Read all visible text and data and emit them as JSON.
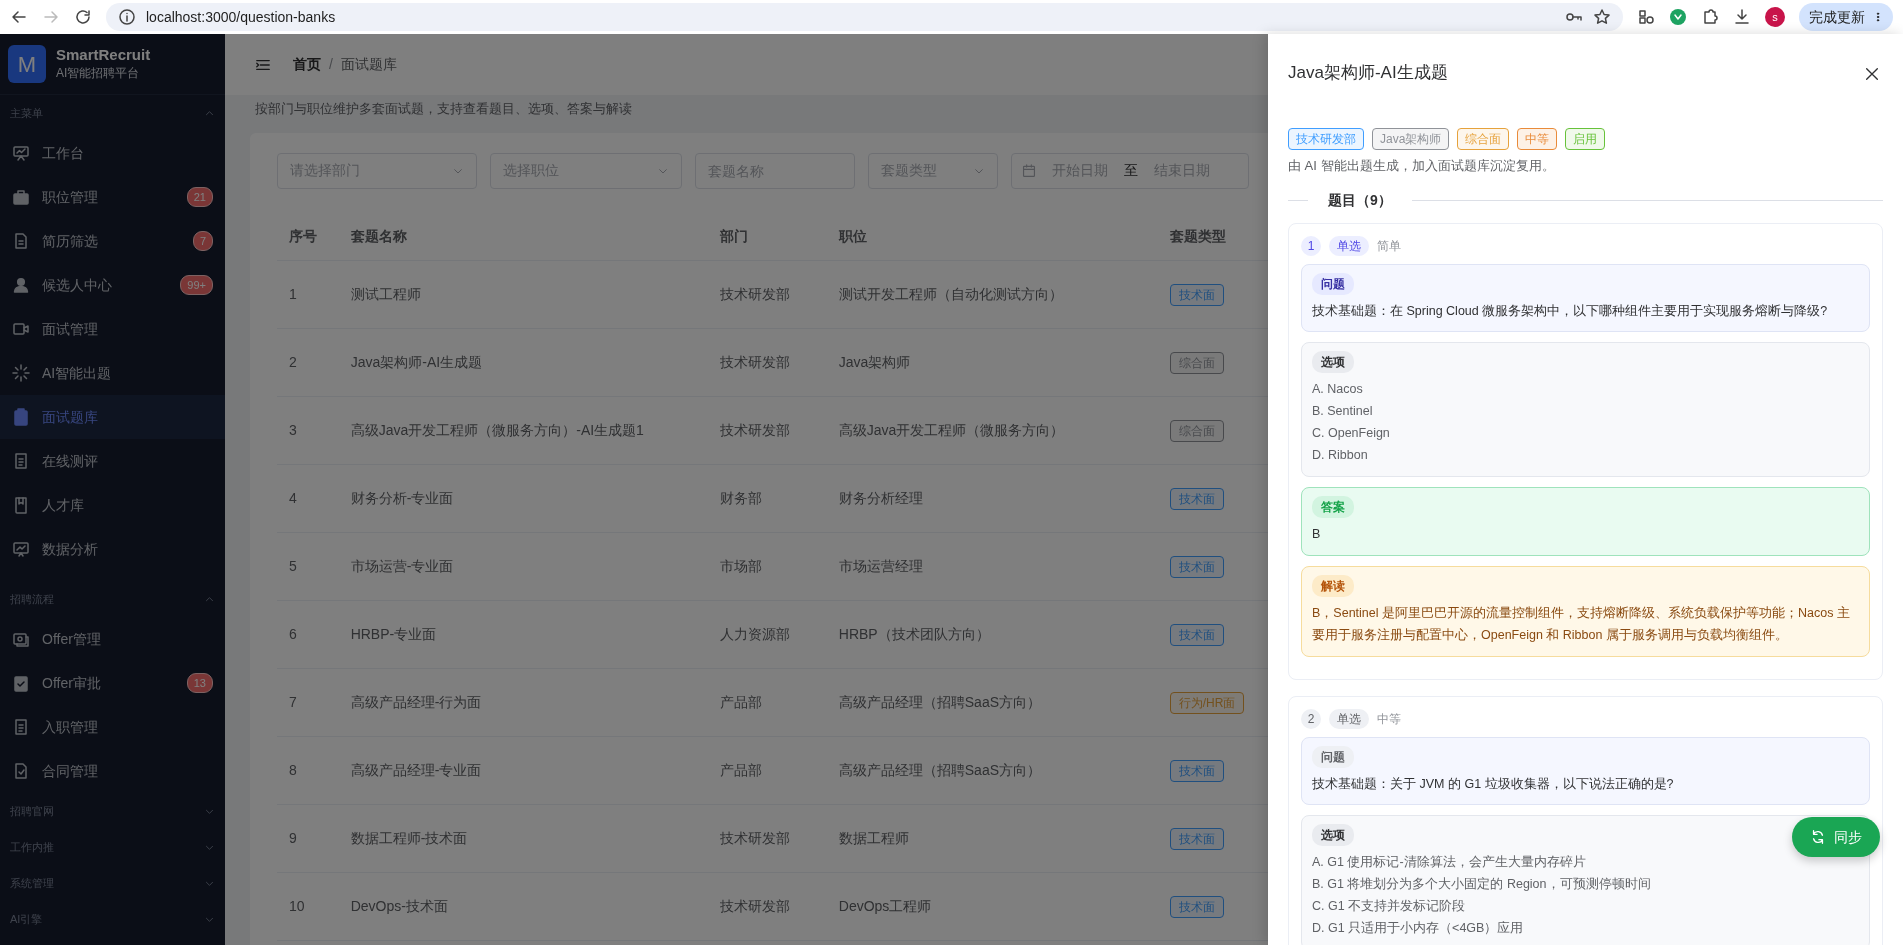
{
  "browser": {
    "url": "localhost:3000/question-banks",
    "avatar": "s",
    "update_button": "完成更新"
  },
  "sidebar": {
    "logo": "M",
    "name": "SmartRecruit",
    "subtitle": "AI智能招聘平台",
    "sections": [
      {
        "title": "主菜单",
        "expanded": true,
        "items": [
          {
            "label": "工作台",
            "selected": false
          },
          {
            "label": "职位管理",
            "badge": "21",
            "selected": false
          },
          {
            "label": "简历筛选",
            "badge": "7",
            "selected": false
          },
          {
            "label": "候选人中心",
            "badge": "99+",
            "selected": false
          },
          {
            "label": "面试管理",
            "selected": false
          },
          {
            "label": "AI智能出题",
            "selected": false
          },
          {
            "label": "面试题库",
            "selected": true
          },
          {
            "label": "在线测评",
            "selected": false
          },
          {
            "label": "人才库",
            "selected": false
          },
          {
            "label": "数据分析",
            "selected": false
          }
        ]
      },
      {
        "title": "招聘流程",
        "expanded": true,
        "items": [
          {
            "label": "Offer管理",
            "selected": false
          },
          {
            "label": "Offer审批",
            "badge": "13",
            "selected": false
          },
          {
            "label": "入职管理",
            "selected": false
          },
          {
            "label": "合同管理",
            "selected": false
          }
        ]
      },
      {
        "title": "招聘官网",
        "expanded": false
      },
      {
        "title": "工作内推",
        "expanded": false
      },
      {
        "title": "系统管理",
        "expanded": false
      },
      {
        "title": "AI引擎",
        "expanded": false
      }
    ]
  },
  "main": {
    "breadcrumb": {
      "items": [
        "首页",
        "面试题库"
      ],
      "separator": "/"
    },
    "description": "按部门与职位维护多套面试题，支持查看题目、选项、答案与解读",
    "filters": [
      {
        "kind": "select",
        "placeholder": "请选择部门"
      },
      {
        "kind": "select",
        "placeholder": "选择职位"
      },
      {
        "kind": "input",
        "placeholder": "套题名称"
      },
      {
        "kind": "select",
        "placeholder": "套题类型"
      },
      {
        "kind": "daterange",
        "start_placeholder": "开始日期",
        "separator": "至",
        "end_placeholder": "结束日期"
      }
    ],
    "table": {
      "columns": [
        "序号",
        "套题名称",
        "部门",
        "职位",
        "套题类型"
      ],
      "rows": [
        {
          "index": "1",
          "name": "测试工程师",
          "department": "技术研发部",
          "position": "测试开发工程师（自动化测试方向）",
          "type": {
            "label": "技术面",
            "kind": "primary"
          }
        },
        {
          "index": "2",
          "name": "Java架构师-AI生成题",
          "department": "技术研发部",
          "position": "Java架构师",
          "type": {
            "label": "综合面",
            "kind": "info"
          }
        },
        {
          "index": "3",
          "name": "高级Java开发工程师（微服务方向）-AI生成题1",
          "department": "技术研发部",
          "position": "高级Java开发工程师（微服务方向）",
          "type": {
            "label": "综合面",
            "kind": "info"
          }
        },
        {
          "index": "4",
          "name": "财务分析-专业面",
          "department": "财务部",
          "position": "财务分析经理",
          "type": {
            "label": "技术面",
            "kind": "primary"
          }
        },
        {
          "index": "5",
          "name": "市场运营-专业面",
          "department": "市场部",
          "position": "市场运营经理",
          "type": {
            "label": "技术面",
            "kind": "primary"
          }
        },
        {
          "index": "6",
          "name": "HRBP-专业面",
          "department": "人力资源部",
          "position": "HRBP（技术团队方向）",
          "type": {
            "label": "技术面",
            "kind": "primary"
          }
        },
        {
          "index": "7",
          "name": "高级产品经理-行为面",
          "department": "产品部",
          "position": "高级产品经理（招聘SaaS方向）",
          "type": {
            "label": "行为/HR面",
            "kind": "warning"
          }
        },
        {
          "index": "8",
          "name": "高级产品经理-专业面",
          "department": "产品部",
          "position": "高级产品经理（招聘SaaS方向）",
          "type": {
            "label": "技术面",
            "kind": "primary"
          }
        },
        {
          "index": "9",
          "name": "数据工程师-技术面",
          "department": "技术研发部",
          "position": "数据工程师",
          "type": {
            "label": "技术面",
            "kind": "primary"
          }
        },
        {
          "index": "10",
          "name": "DevOps-技术面",
          "department": "技术研发部",
          "position": "DevOps工程师",
          "type": {
            "label": "技术面",
            "kind": "primary"
          }
        }
      ]
    }
  },
  "drawer": {
    "title": "Java架构师-AI生成题",
    "tags": [
      {
        "label": "技术研发部",
        "kind": "primary"
      },
      {
        "label": "Java架构师",
        "kind": "info"
      },
      {
        "label": "综合面",
        "kind": "warning"
      },
      {
        "label": "中等",
        "kind": "orange"
      },
      {
        "label": "启用",
        "kind": "success"
      }
    ],
    "note": "由 AI 智能出题生成，加入面试题库沉淀复用。",
    "questions_heading": "题目（9）",
    "questions": [
      {
        "number": "1",
        "type": "单选",
        "difficulty": "简单",
        "active": true,
        "sections": [
          {
            "kind": "question",
            "label": "问题",
            "text": "技术基础题：在 Spring Cloud 微服务架构中，以下哪种组件主要用于实现服务熔断与降级?"
          },
          {
            "kind": "options",
            "label": "选项",
            "options": [
              "A. Nacos",
              "B. Sentinel",
              "C. OpenFeign",
              "D. Ribbon"
            ]
          },
          {
            "kind": "answer",
            "label": "答案",
            "text": "B"
          },
          {
            "kind": "explanation",
            "label": "解读",
            "text": "B，Sentinel 是阿里巴巴开源的流量控制组件，支持熔断降级、系统负载保护等功能；Nacos 主要用于服务注册与配置中心，OpenFeign 和 Ribbon 属于服务调用与负载均衡组件。"
          }
        ]
      },
      {
        "number": "2",
        "type": "单选",
        "difficulty": "中等",
        "active": false,
        "sections": [
          {
            "kind": "question",
            "label": "问题",
            "text": "技术基础题：关于 JVM 的 G1 垃圾收集器，以下说法正确的是?"
          },
          {
            "kind": "options",
            "label": "选项",
            "options": [
              "A. G1 使用标记-清除算法，会产生大量内存碎片",
              "B. G1 将堆划分为多个大小固定的 Region，可预测停顿时间",
              "C. G1 不支持并发标记阶段",
              "D. G1 只适用于小内存（<4GB）应用"
            ]
          }
        ]
      }
    ],
    "sync_button": "同步"
  }
}
